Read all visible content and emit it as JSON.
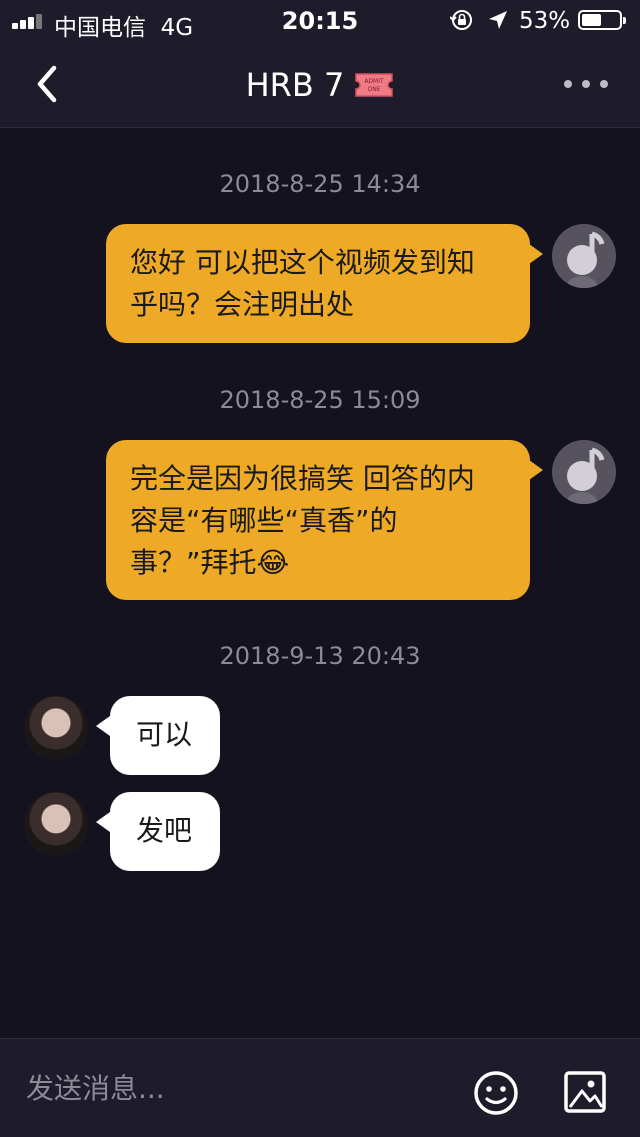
{
  "status_bar": {
    "carrier": "中国电信",
    "network": "4G",
    "time": "20:15",
    "battery_percent": "53%",
    "battery_level": 0.53
  },
  "header": {
    "back_icon": "chevron-left-icon",
    "title": "HRB 7",
    "badge_icon": "admit-one-ticket-icon",
    "badge_text": [
      "ADMIT",
      "ONE"
    ],
    "more_icon": "more-horizontal-icon"
  },
  "messages": [
    {
      "timestamp": "2018-8-25 14:34",
      "sender": "self",
      "lines": [
        "您好 可以把这个视频发到知",
        "乎吗？会注明出处"
      ]
    },
    {
      "timestamp": "2018-8-25 15:09",
      "sender": "self",
      "lines": [
        "完全是因为很搞笑 回答的内",
        "容是“有哪些“真香”的",
        "事？”拜托"
      ],
      "emoji": "😂"
    },
    {
      "timestamp": "2018-9-13 20:43",
      "sender": "other",
      "text": "可以"
    },
    {
      "sender": "other",
      "text": "发吧"
    }
  ],
  "input": {
    "placeholder": "发送消息...",
    "emoji_icon": "smiley-face-icon",
    "image_icon": "image-icon"
  },
  "colors": {
    "background": "#14121f",
    "bar": "#1e1c2b",
    "outgoing_bubble": "#eeaa27",
    "incoming_bubble": "#ffffff",
    "timestamp_text": "#8c8a96"
  }
}
